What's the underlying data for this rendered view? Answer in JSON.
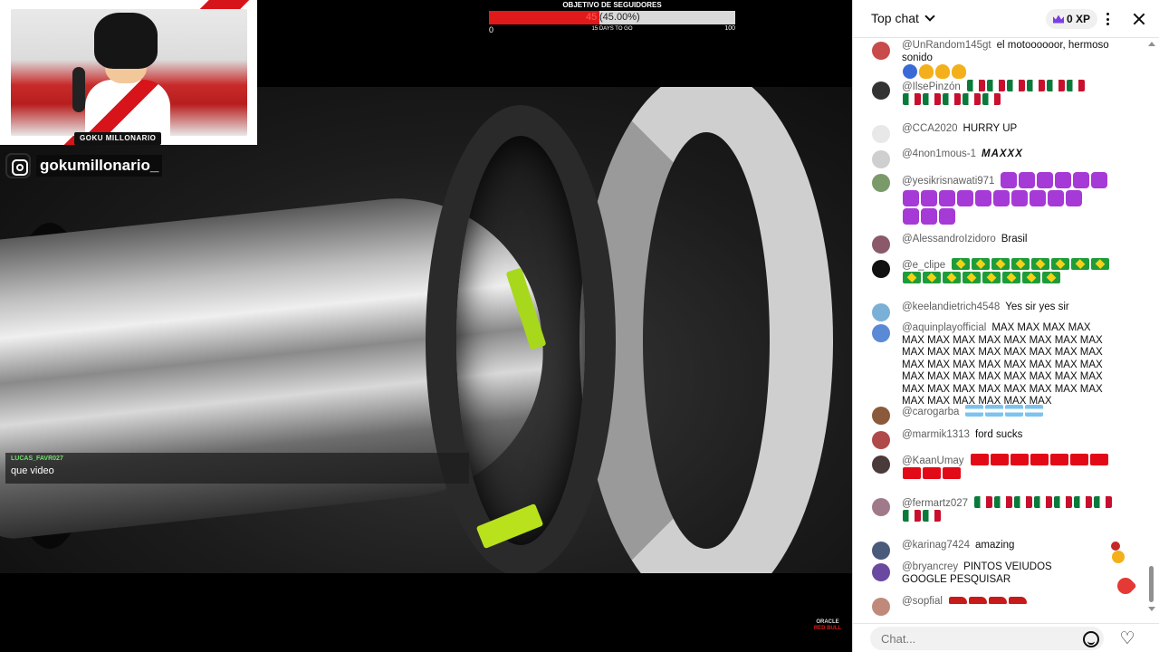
{
  "stream": {
    "brand_tag": "GOKU MILLONARIO",
    "instagram_handle": "gokumillonario_",
    "goal": {
      "title": "OBJETIVO DE SEGUIDORES",
      "current": "45",
      "percent_label": "(45.00%)",
      "progress": 0.45,
      "min": "0",
      "max": "100",
      "days_left": "15 DAYS TO GO",
      "fill_color": "#e01a1a"
    },
    "overlay_chat": {
      "user": "LUCAS_FAVR027",
      "text": "que video"
    },
    "sponsor": {
      "line1": "ORACLE",
      "line2": "RED BULL"
    }
  },
  "chat": {
    "mode_label": "Top chat",
    "xp_label": "0 XP",
    "input_placeholder": "Chat...",
    "messages": [
      {
        "user": "@UnRandom145gt",
        "text": "el motoooooor, hermoso sonido",
        "avatar": "#c94a4a"
      },
      {
        "user": "@IlsePinzón",
        "text": "",
        "avatar": "#333"
      },
      {
        "user": "@CCA2020",
        "text": "HURRY UP",
        "avatar": "#e8e8e8"
      },
      {
        "user": "@4non1mous-1",
        "text": "MAXXX",
        "avatar": "#cfcfcf"
      },
      {
        "user": "@yesikrisnawati971",
        "text": "",
        "avatar": "#7a9a6a"
      },
      {
        "user": "@AlessandroIzidoro",
        "text": "Brasil",
        "avatar": "#8a5a6a"
      },
      {
        "user": "@e_clipe",
        "text": "",
        "avatar": "#111"
      },
      {
        "user": "@keelandietrich4548",
        "text": "Yes sir yes sir",
        "avatar": "#7ab0d6"
      },
      {
        "user": "@aquinplayofficial",
        "text": "MAX MAX MAX MAX MAX MAX MAX MAX MAX MAX MAX MAX MAX MAX MAX MAX MAX MAX MAX MAX MAX MAX MAX MAX MAX MAX MAX MAX MAX MAX MAX MAX MAX MAX MAX MAX MAX MAX MAX MAX MAX MAX MAX MAX MAX MAX MAX MAX MAX MAX",
        "avatar": "#5a8ad6"
      },
      {
        "user": "@carogarba",
        "text": "",
        "avatar": "#8a5a3a"
      },
      {
        "user": "@marmik1313",
        "text": "ford sucks",
        "avatar": "#b04a4a"
      },
      {
        "user": "@KaanUmay",
        "text": "",
        "avatar": "#4a3a3a"
      },
      {
        "user": "@fermartz027",
        "text": "",
        "avatar": "#a07a8a"
      },
      {
        "user": "@karinag7424",
        "text": "amazing",
        "avatar": "#4a5a7a"
      },
      {
        "user": "@bryancrey",
        "text": "PINTOS VEIUDOS GOOGLE PESQUISAR",
        "avatar": "#6a4aa0"
      },
      {
        "user": "@sopfial",
        "text": "",
        "avatar": "#c08a7a"
      }
    ]
  },
  "colors": {
    "accent_red": "#e01a1a",
    "chat_bg": "#ffffff",
    "username": "#606060"
  },
  "icons": [
    "instagram-icon",
    "chevron-down-icon",
    "crown-icon",
    "more-vert-icon",
    "close-icon",
    "emoji-icon",
    "heart-icon"
  ]
}
